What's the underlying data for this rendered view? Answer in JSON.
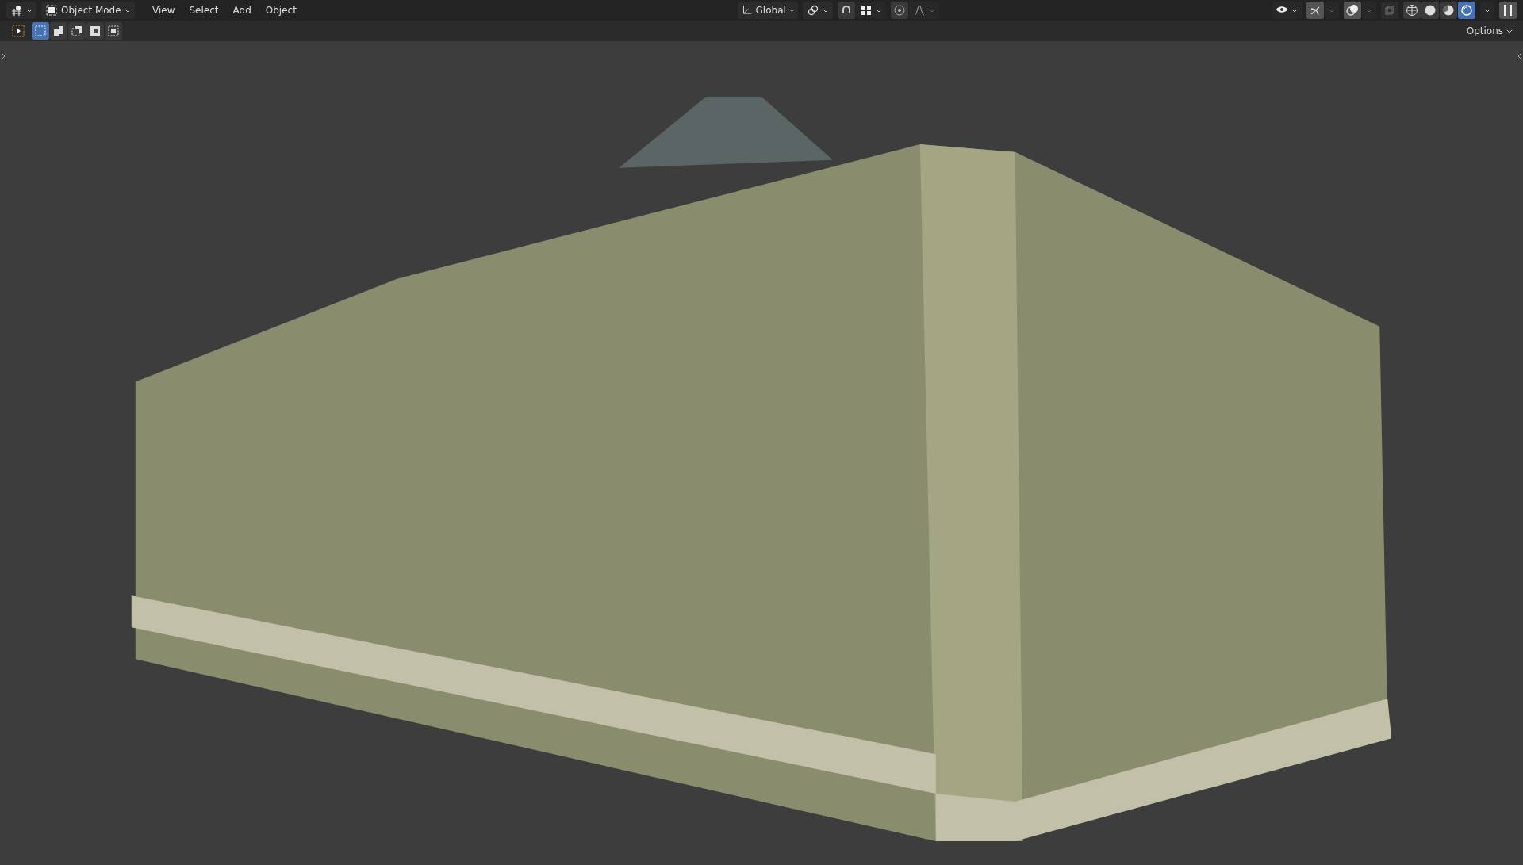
{
  "header": {
    "mode": {
      "label": "Object Mode"
    },
    "menus": [
      "View",
      "Select",
      "Add",
      "Object"
    ],
    "orientation": {
      "label": "Global"
    },
    "snap": {
      "on": false
    },
    "proportional": {
      "on": false
    },
    "shading_modes": [
      {
        "kind": "wireframe",
        "selected": false
      },
      {
        "kind": "solid",
        "selected": false
      },
      {
        "kind": "material",
        "selected": false
      },
      {
        "kind": "rendered",
        "selected": true
      }
    ]
  },
  "tool_header": {
    "select_modes": [
      {
        "kind": "new",
        "selected": true
      },
      {
        "kind": "extend",
        "selected": false
      },
      {
        "kind": "subtract",
        "selected": false
      },
      {
        "kind": "invert",
        "selected": false
      },
      {
        "kind": "intersect",
        "selected": false
      }
    ],
    "options": "Options"
  }
}
